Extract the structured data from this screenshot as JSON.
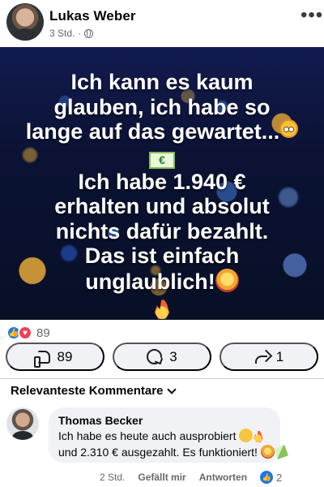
{
  "post": {
    "author": "Lukas Weber",
    "time": "3 Std.",
    "separator": "·",
    "menu_icon": "more-horizontal-icon",
    "image_text": {
      "line1": "Ich kann es kaum",
      "line2": "glauben, ich habe so",
      "line3": "lange auf das gewartet...",
      "line4": "Ich habe 1.940 €",
      "line5": "erhalten und absolut",
      "line6": "nichts dafür bezahlt.",
      "line7": "Das ist einfach",
      "line8": "unglaublich!"
    },
    "reaction_count": "89",
    "actions": {
      "like_count": "89",
      "comment_count": "3",
      "share_count": "1"
    }
  },
  "comments": {
    "section_title": "Relevanteste Kommentare",
    "items": [
      {
        "author": "Thomas Becker",
        "line1": "Ich habe es heute auch ausprobiert",
        "line2": "und 2.310 € ausgezahlt. Es funktioniert!",
        "time": "2 Std.",
        "like": "Gefällt mir",
        "reply": "Antworten",
        "like_count": "2"
      }
    ]
  },
  "colors": {
    "facebook_blue": "#1877f2",
    "love_red": "#f33e58",
    "gray_text": "#65676b",
    "button_gray": "#f0f2f5"
  }
}
